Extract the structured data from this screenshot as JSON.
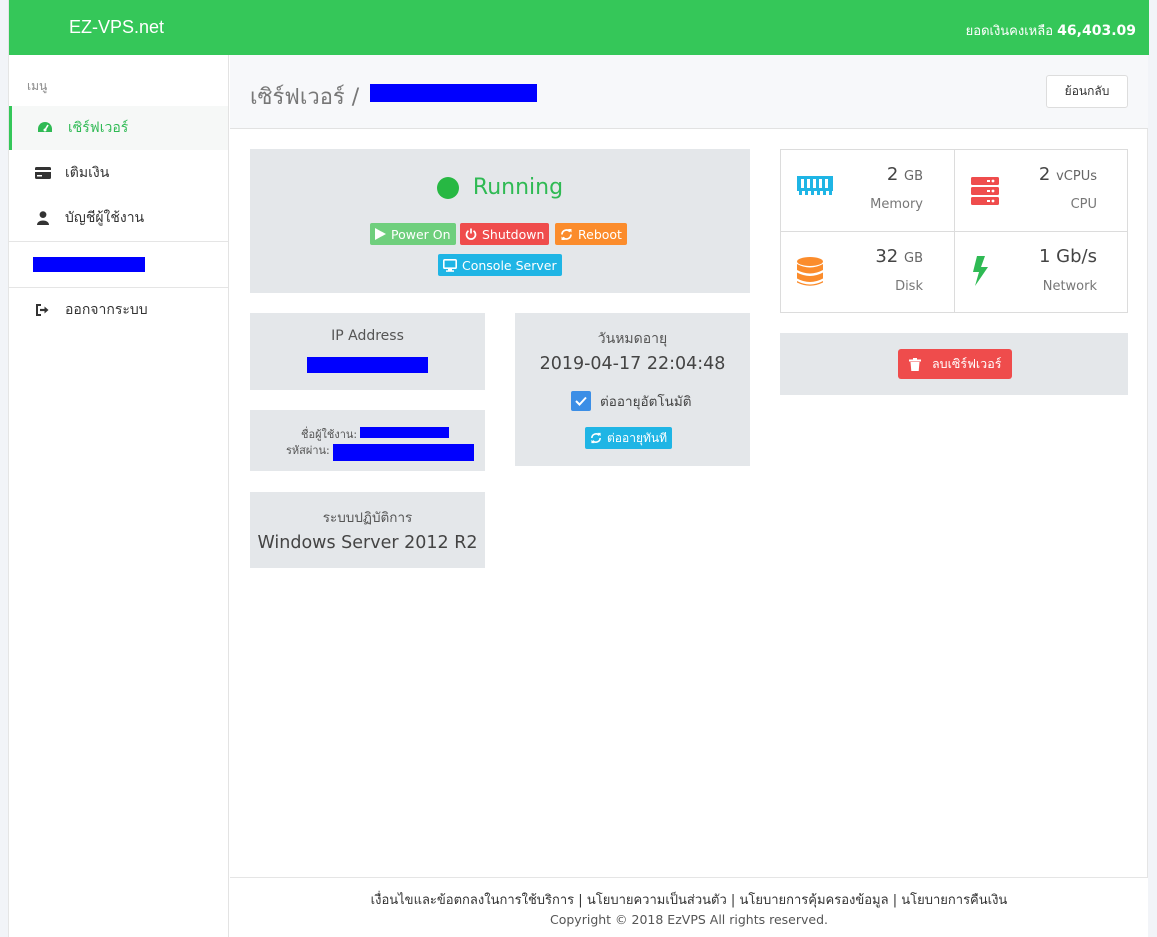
{
  "brand": "EZ-VPS.net",
  "balance": {
    "label": "ยอดเงินคงเหลือ",
    "amount": "46,403.09"
  },
  "sidebar": {
    "heading": "เมนู",
    "items": [
      {
        "label": "เซิร์ฟเวอร์",
        "icon": "dashboard-icon",
        "active": true
      },
      {
        "label": "เติมเงิน",
        "icon": "credit-card-icon"
      },
      {
        "label": "บัญชีผู้ใช้งาน",
        "icon": "user-icon"
      }
    ],
    "logout": "ออกจากระบบ"
  },
  "header": {
    "title": "เซิร์ฟเวอร์ /",
    "back_label": "ย้อนกลับ"
  },
  "status": {
    "state": "Running",
    "buttons": {
      "power_on": "Power On",
      "shutdown": "Shutdown",
      "reboot": "Reboot",
      "console": "Console Server"
    }
  },
  "ip": {
    "label": "IP Address"
  },
  "credentials": {
    "username_label": "ชื่อผู้ใช้งาน:",
    "password_label": "รหัสผ่าน:"
  },
  "os": {
    "label": "ระบบปฏิบัติการ",
    "value": "Windows Server 2012 R2"
  },
  "expiry": {
    "label": "วันหมดอายุ",
    "value": "2019-04-17 22:04:48",
    "auto_renew_label": "ต่ออายุอัตโนมัติ",
    "auto_renew_checked": true,
    "renew_now": "ต่ออายุทันที"
  },
  "specs": {
    "memory": {
      "value": "2",
      "unit": "GB",
      "label": "Memory"
    },
    "cpu": {
      "value": "2",
      "unit": "vCPUs",
      "label": "CPU"
    },
    "disk": {
      "value": "32",
      "unit": "GB",
      "label": "Disk"
    },
    "network": {
      "value": "1 Gb/s",
      "label": "Network"
    }
  },
  "delete_label": "ลบเซิร์ฟเวอร์",
  "footer": {
    "links": [
      "เงื่อนไขและข้อตกลงในการใช้บริการ",
      "นโยบายความเป็นส่วนตัว",
      "นโยบายการคุ้มครองข้อมูล",
      "นโยบายการคืนเงิน"
    ],
    "separator": " | ",
    "copyright": "Copyright © 2018 EzVPS All rights reserved."
  },
  "colors": {
    "brand_green": "#35c759",
    "danger": "#ef4c4c",
    "warning": "#fb8c2c",
    "info": "#1fb5e5",
    "power_on": "#6fcf7d"
  }
}
